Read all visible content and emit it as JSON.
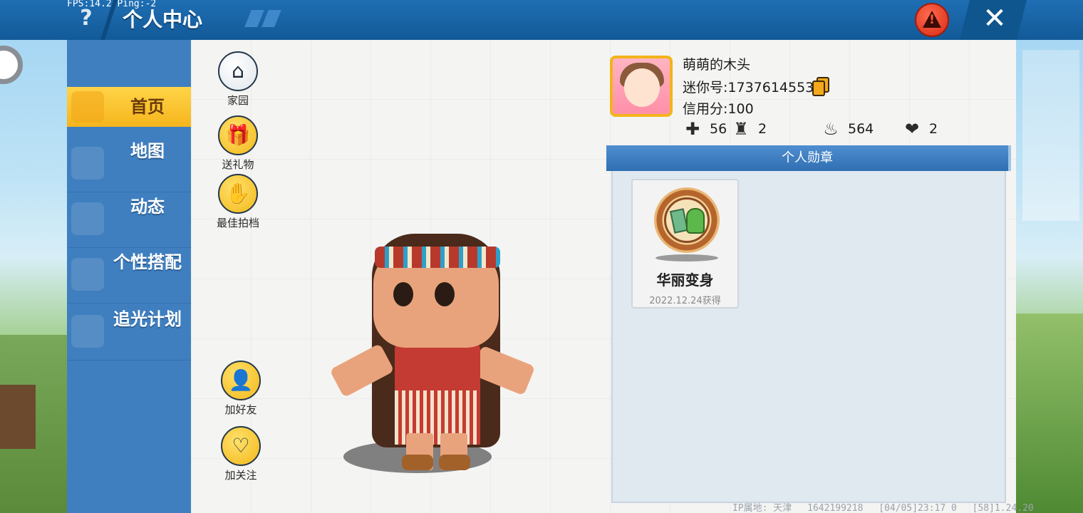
{
  "topbar": {
    "fps_text": "FPS:14.2  Ping:-2",
    "help_glyph": "?",
    "title": "个人中心",
    "close_glyph": "✕",
    "warn_glyph": "!"
  },
  "sidebar": {
    "items": [
      {
        "label": "首页",
        "icon": "home-tab-icon",
        "active": true
      },
      {
        "label": "地图",
        "icon": "map-icon"
      },
      {
        "label": "动态",
        "icon": "bell-icon"
      },
      {
        "label": "个性搭配",
        "icon": "outfit-icon"
      },
      {
        "label": "追光计划",
        "icon": "chase-light-icon"
      }
    ]
  },
  "actions": {
    "home": {
      "label": "家园",
      "icon": "house-icon"
    },
    "gift": {
      "label": "送礼物",
      "icon": "gift-icon"
    },
    "partner": {
      "label": "最佳拍档",
      "icon": "handshake-icon"
    },
    "add_friend": {
      "label": "加好友",
      "icon": "add-user-icon"
    },
    "follow": {
      "label": "加关注",
      "icon": "heart-icon"
    }
  },
  "profile": {
    "name": "萌萌的木头",
    "mini_id": "迷你号:1737614553",
    "credit": "信用分:100",
    "stats": [
      {
        "icon": "bookmark-plus-icon",
        "glyph": "✚",
        "value": "56"
      },
      {
        "icon": "cheer-icon",
        "glyph": "♜",
        "value": "2"
      },
      {
        "icon": "fire-icon",
        "glyph": "♨",
        "value": "564"
      },
      {
        "icon": "hearts-icon",
        "glyph": "❤",
        "value": "2"
      }
    ]
  },
  "medals": {
    "header": "个人勋章",
    "items": [
      {
        "name": "华丽变身",
        "date": "2022.12.24获得"
      }
    ]
  },
  "footer": {
    "ip": "IP属地: 天津",
    "uid": "1642199218",
    "time": "[04/05]23:17 0",
    "version": "[58]1.24.20"
  },
  "colors": {
    "topbar": "#1866a8",
    "sidebar": "#3f7fc0",
    "active_tab": "#f8c232",
    "medal_header": "#3f7fc0",
    "warn": "#e33a1f"
  }
}
